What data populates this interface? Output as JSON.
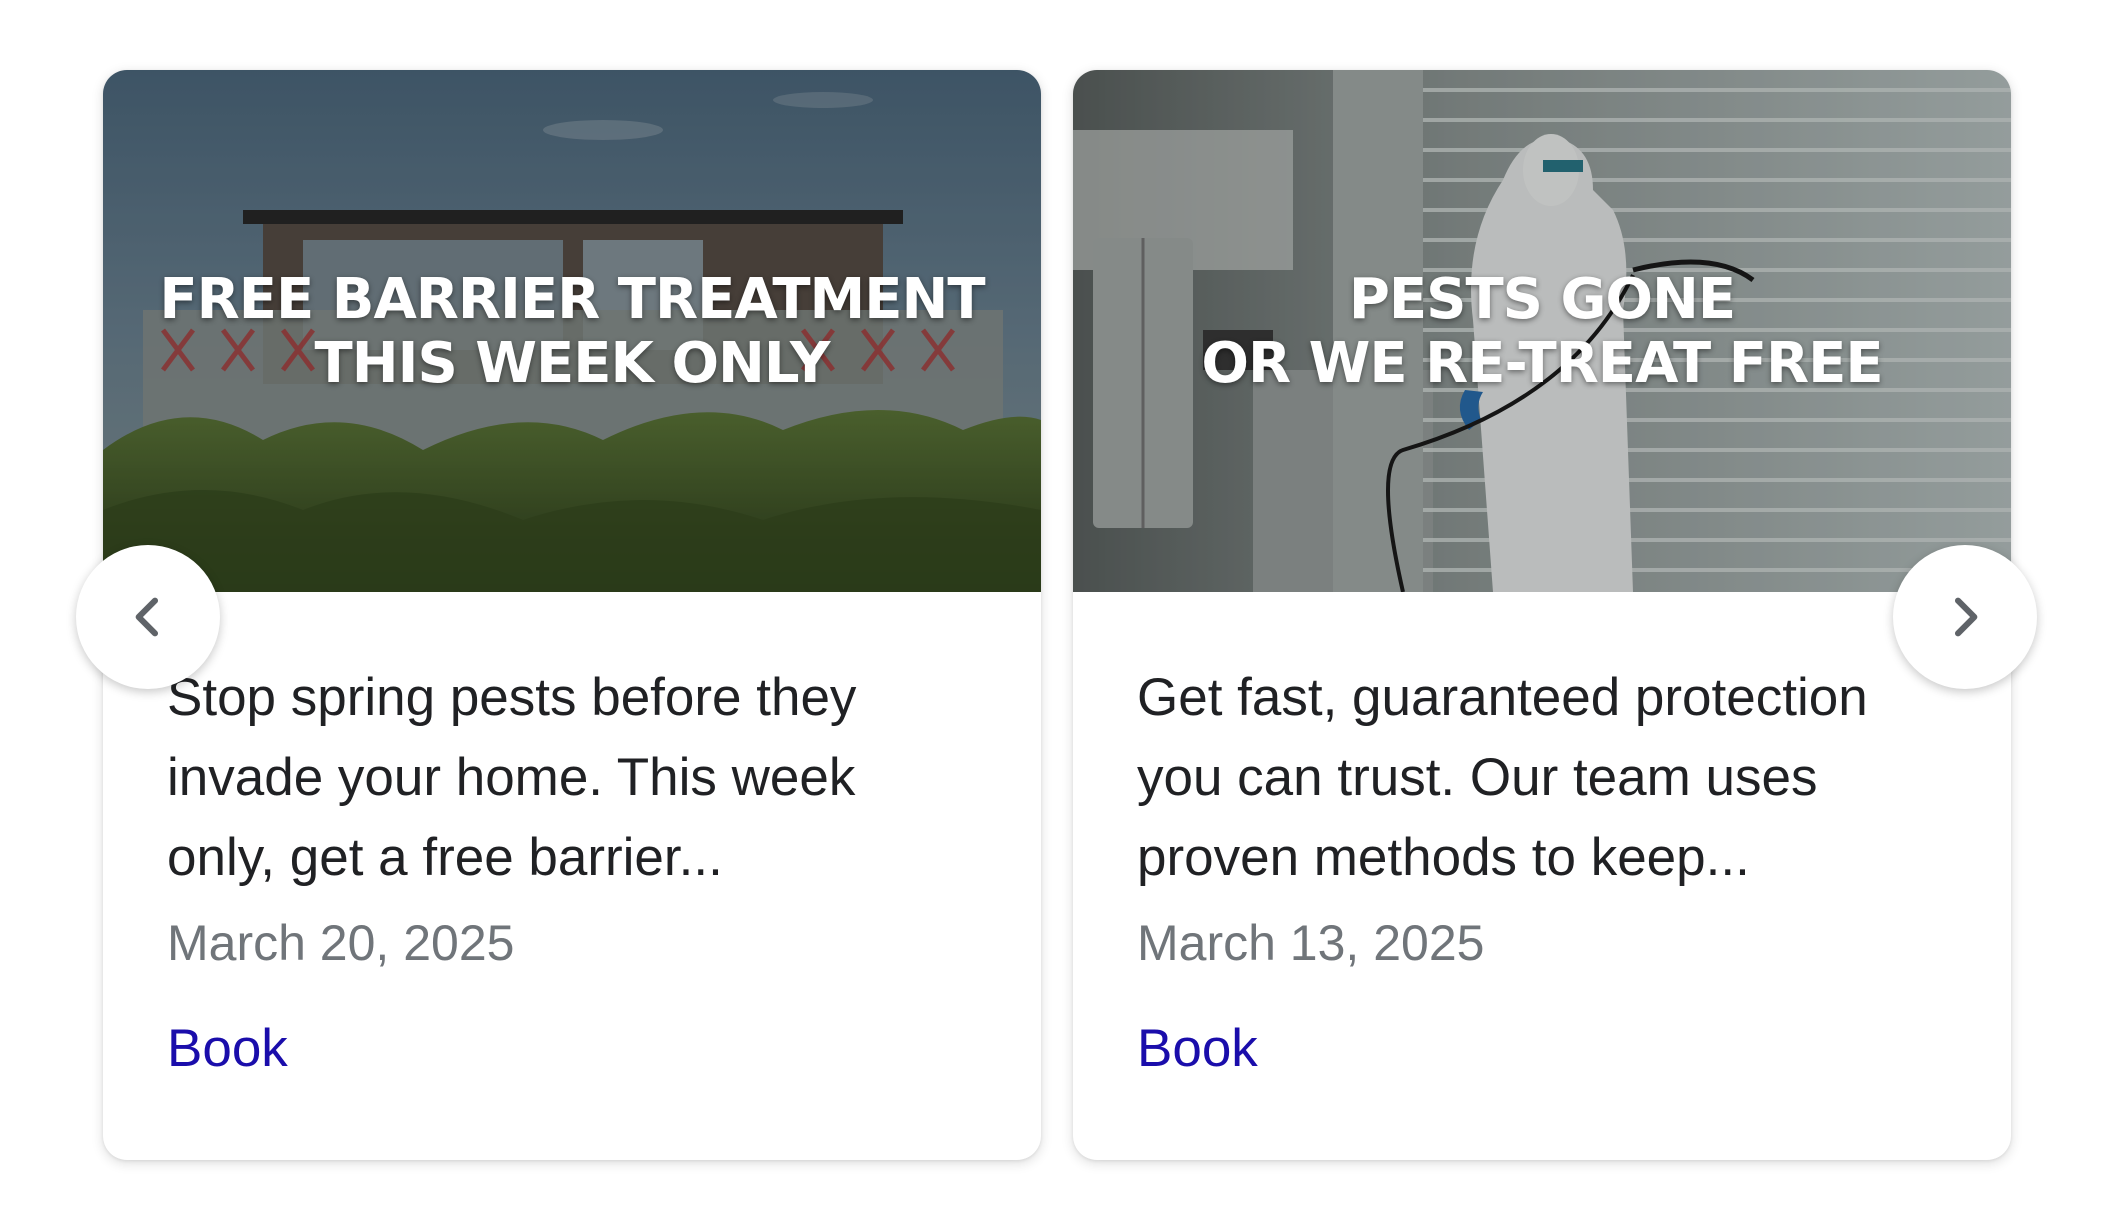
{
  "cards": [
    {
      "headline_line1": "FREE BARRIER TREATMENT",
      "headline_line2": "THIS WEEK ONLY",
      "description": "Stop spring pests before they invade your home. This week only, get a free barrier...",
      "date": "March 20, 2025",
      "action": "Book"
    },
    {
      "headline_line1": "PESTS GONE",
      "headline_line2": "OR WE RE-TREAT FREE",
      "description": "Get fast, guaranteed protection you can trust. Our team uses proven methods to keep...",
      "date": "March 13, 2025",
      "action": "Book"
    }
  ],
  "navigation": {
    "prev_icon": "chevron-left-icon",
    "next_icon": "chevron-right-icon"
  },
  "colors": {
    "link": "#1a0dab",
    "date": "#70757a",
    "text": "#202124"
  }
}
